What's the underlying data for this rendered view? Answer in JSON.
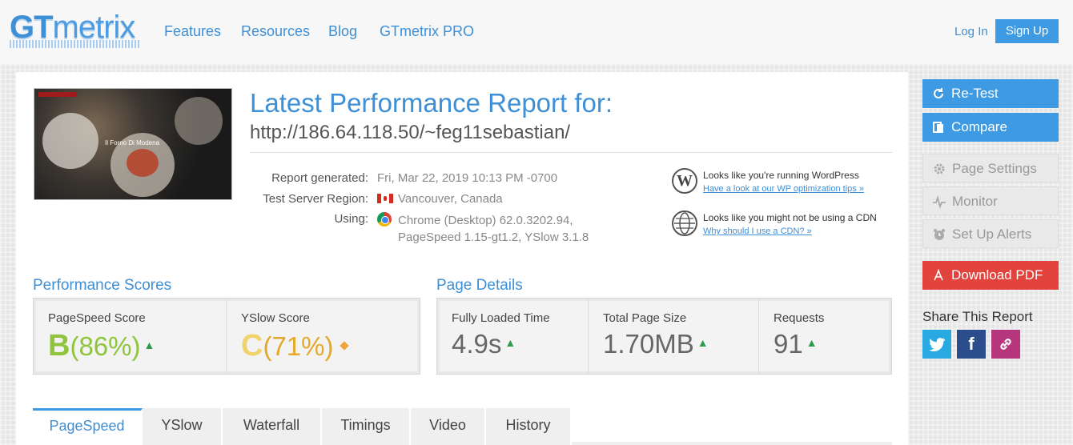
{
  "header": {
    "logo": {
      "bold": "GT",
      "lite": "metrix"
    },
    "nav": [
      "Features",
      "Resources",
      "Blog",
      "GTmetrix PRO"
    ],
    "login": "Log In",
    "signup": "Sign Up"
  },
  "thumbnail": {
    "site_title": "Il Forno Di Modena"
  },
  "report": {
    "title": "Latest Performance Report for:",
    "url": "http://186.64.118.50/~feg11sebastian/",
    "generated_label": "Report generated:",
    "generated_value": "Fri, Mar 22, 2019 10:13 PM -0700",
    "region_label": "Test Server Region:",
    "region_value": "Vancouver, Canada",
    "using_label": "Using:",
    "using_line1": "Chrome (Desktop) 62.0.3202.94,",
    "using_line2": "PageSpeed 1.15-gt1.2, YSlow 3.1.8"
  },
  "tips": [
    {
      "text": "Looks like you're running WordPress",
      "link": "Have a look at our WP optimization tips »"
    },
    {
      "text": "Looks like you might not be using a CDN",
      "link": "Why should I use a CDN? »"
    }
  ],
  "performance_scores": {
    "title": "Performance Scores",
    "pagespeed": {
      "label": "PageSpeed Score",
      "grade": "B",
      "percent": "(86%)"
    },
    "yslow": {
      "label": "YSlow Score",
      "grade": "C",
      "percent": "(71%)"
    }
  },
  "page_details": {
    "title": "Page Details",
    "loaded": {
      "label": "Fully Loaded Time",
      "value": "4.9s"
    },
    "size": {
      "label": "Total Page Size",
      "value": "1.70MB"
    },
    "requests": {
      "label": "Requests",
      "value": "91"
    }
  },
  "tabs": [
    "PageSpeed",
    "YSlow",
    "Waterfall",
    "Timings",
    "Video",
    "History"
  ],
  "sidebar": {
    "retest": "Re-Test",
    "compare": "Compare",
    "page_settings": "Page Settings",
    "monitor": "Monitor",
    "alerts": "Set Up Alerts",
    "download": "Download PDF",
    "share_title": "Share This Report"
  },
  "colors": {
    "accent": "#3d9ae3",
    "grade_b": "#8fc43c",
    "grade_c": "#e5a92a",
    "download": "#e2433c"
  },
  "icons": [
    "refresh-icon",
    "compare-icon",
    "gear-icon",
    "pulse-icon",
    "alarm-icon",
    "pdf-icon",
    "twitter-icon",
    "facebook-icon",
    "link-icon",
    "wordpress-icon",
    "globe-icon",
    "canada-flag-icon",
    "chrome-icon",
    "arrow-up-icon",
    "diamond-icon"
  ]
}
